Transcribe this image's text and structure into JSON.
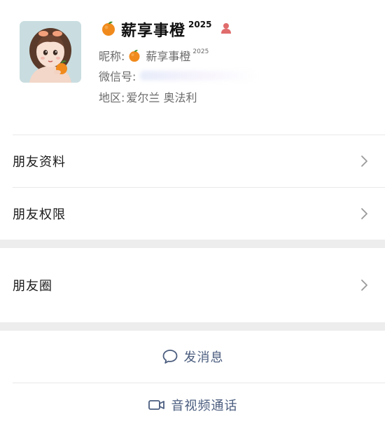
{
  "profile": {
    "display_name": "薪享事橙",
    "name_superscript": "2025",
    "nickname_label": "昵称:",
    "nickname": "薪享事橙",
    "nickname_superscript": "2025",
    "wechat_id_label": "微信号:",
    "region_label": "地区:",
    "region": "爱尔兰 奥法利"
  },
  "menu": {
    "friend_profile": "朋友资料",
    "friend_permissions": "朋友权限",
    "moments": "朋友圈"
  },
  "actions": {
    "send_message": "发消息",
    "av_call": "音视频通话"
  },
  "colors": {
    "action_text": "#4b5d7f",
    "gender_icon": "#e06c6c",
    "orange": "#f08a1c"
  },
  "icons": {
    "name_prefix": "orange-icon",
    "gender": "female-user-icon",
    "chevron": "chevron-right-icon",
    "message": "chat-bubble-icon",
    "call": "video-camera-icon"
  }
}
